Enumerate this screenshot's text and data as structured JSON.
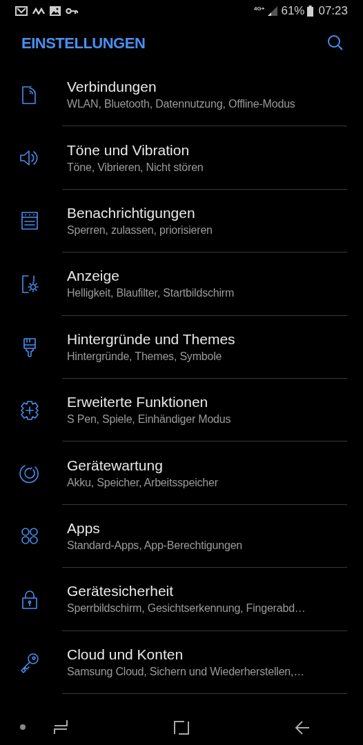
{
  "status_bar": {
    "network": "4G+",
    "battery": "61%",
    "time": "07:23"
  },
  "header": {
    "title": "EINSTELLUNGEN"
  },
  "items": [
    {
      "title": "Verbindungen",
      "subtitle": "WLAN, Bluetooth, Datennutzung, Offline-Modus"
    },
    {
      "title": "Töne und Vibration",
      "subtitle": "Töne, Vibrieren, Nicht stören"
    },
    {
      "title": "Benachrichtigungen",
      "subtitle": "Sperren, zulassen, priorisieren"
    },
    {
      "title": "Anzeige",
      "subtitle": "Helligkeit, Blaufilter, Startbildschirm"
    },
    {
      "title": "Hintergründe und Themes",
      "subtitle": "Hintergründe, Themes, Symbole"
    },
    {
      "title": "Erweiterte Funktionen",
      "subtitle": "S Pen, Spiele, Einhändiger Modus"
    },
    {
      "title": "Gerätewartung",
      "subtitle": "Akku, Speicher, Arbeitsspeicher"
    },
    {
      "title": "Apps",
      "subtitle": "Standard-Apps, App-Berechtigungen"
    },
    {
      "title": "Gerätesicherheit",
      "subtitle": "Sperrbildschirm, Gesichtserkennung, Fingerabd…"
    },
    {
      "title": "Cloud und Konten",
      "subtitle": "Samsung Cloud, Sichern und Wiederherstellen,…"
    }
  ]
}
